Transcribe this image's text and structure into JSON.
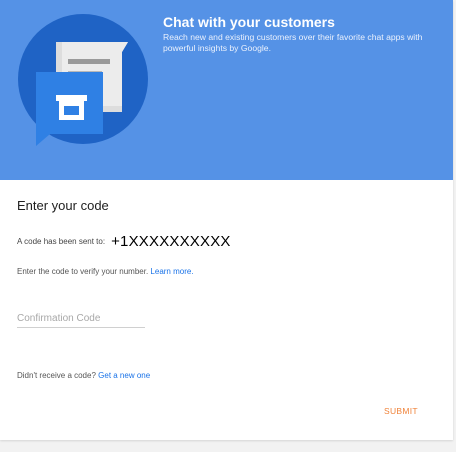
{
  "hero": {
    "title": "Chat with your customers",
    "subtitle": "Reach new and existing customers over their favorite chat apps with powerful insights by Google.",
    "illustration_icon": "storefront-chat-icon",
    "background_color": "#5592e6"
  },
  "form": {
    "heading": "Enter your code",
    "sent_label": "A code has been sent to:",
    "phone_number": "+1XXXXXXXXXX",
    "verify_text": "Enter the code to verify your number.",
    "learn_more_link": "Learn more.",
    "code_placeholder": "Confirmation Code",
    "code_value": "",
    "resend_text": "Didn't receive a code?",
    "resend_link": "Get a new one",
    "submit_label": "SUBMIT"
  },
  "colors": {
    "accent_orange": "#f0833a",
    "link_blue": "#1a73e8"
  }
}
